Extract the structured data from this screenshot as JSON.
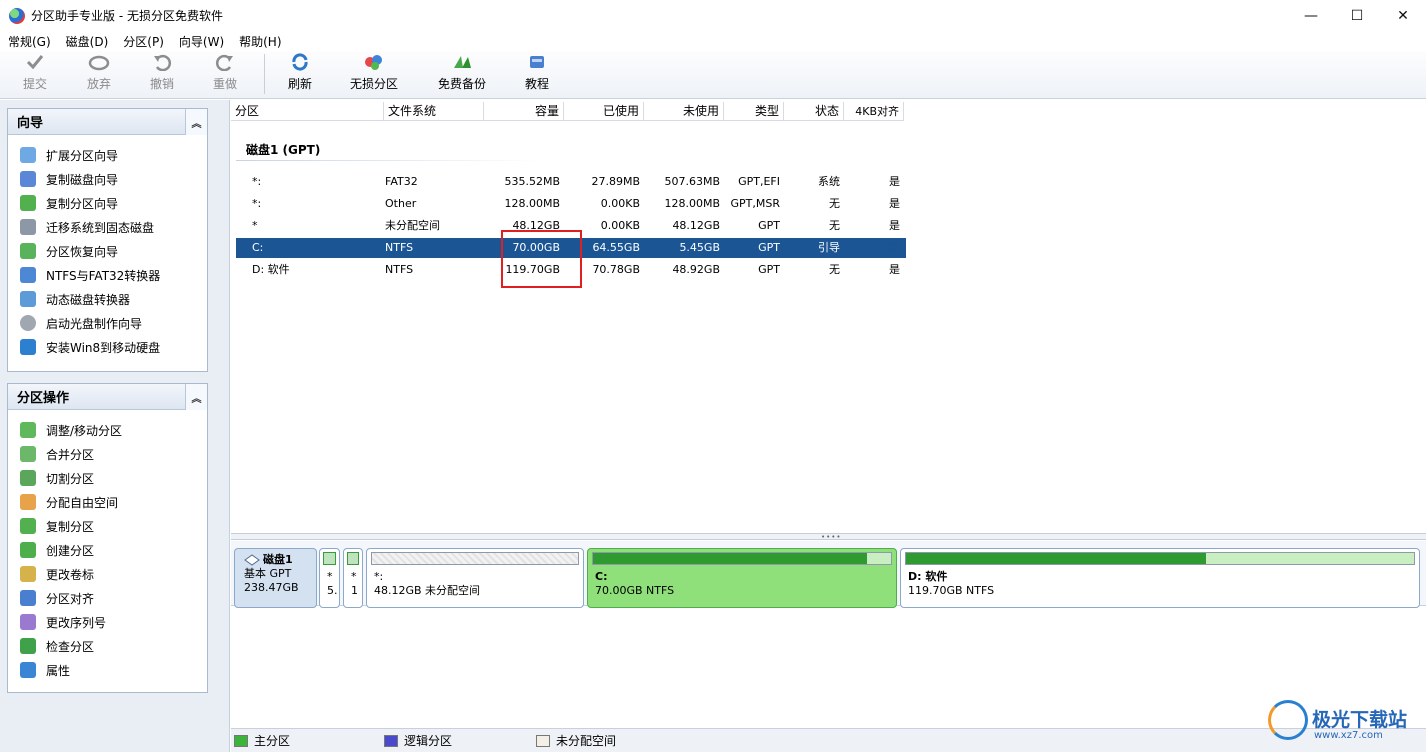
{
  "window": {
    "title": "分区助手专业版 - 无损分区免费软件",
    "minimize": "—",
    "maximize": "☐",
    "close": "✕"
  },
  "menu": [
    "常规(G)",
    "磁盘(D)",
    "分区(P)",
    "向导(W)",
    "帮助(H)"
  ],
  "toolbar": {
    "commit": "提交",
    "discard": "放弃",
    "undo": "撤销",
    "redo": "重做",
    "refresh": "刷新",
    "lossless": "无损分区",
    "backup": "免费备份",
    "tutorial": "教程"
  },
  "wizard_panel": {
    "title": "向导",
    "items": [
      "扩展分区向导",
      "复制磁盘向导",
      "复制分区向导",
      "迁移系统到固态磁盘",
      "分区恢复向导",
      "NTFS与FAT32转换器",
      "动态磁盘转换器",
      "启动光盘制作向导",
      "安装Win8到移动硬盘"
    ]
  },
  "ops_panel": {
    "title": "分区操作",
    "items": [
      "调整/移动分区",
      "合并分区",
      "切割分区",
      "分配自由空间",
      "复制分区",
      "创建分区",
      "更改卷标",
      "分区对齐",
      "更改序列号",
      "检查分区",
      "属性"
    ]
  },
  "columns": [
    "分区",
    "文件系统",
    "容量",
    "已使用",
    "未使用",
    "类型",
    "状态",
    "4KB对齐"
  ],
  "disk_label": "磁盘1 (GPT)",
  "rows": [
    {
      "name": "*:",
      "fs": "FAT32",
      "cap": "535.52MB",
      "used": "27.89MB",
      "free": "507.63MB",
      "type": "GPT,EFI",
      "status": "系统",
      "align": "是"
    },
    {
      "name": "*:",
      "fs": "Other",
      "cap": "128.00MB",
      "used": "0.00KB",
      "free": "128.00MB",
      "type": "GPT,MSR",
      "status": "无",
      "align": "是"
    },
    {
      "name": "*",
      "fs": "未分配空间",
      "cap": "48.12GB",
      "used": "0.00KB",
      "free": "48.12GB",
      "type": "GPT",
      "status": "无",
      "align": "是"
    },
    {
      "name": "C:",
      "fs": "NTFS",
      "cap": "70.00GB",
      "used": "64.55GB",
      "free": "5.45GB",
      "type": "GPT",
      "status": "引导",
      "align": "是"
    },
    {
      "name": "D: 软件",
      "fs": "NTFS",
      "cap": "119.70GB",
      "used": "70.78GB",
      "free": "48.92GB",
      "type": "GPT",
      "status": "无",
      "align": "是"
    }
  ],
  "diskmap": {
    "disk": {
      "name": "磁盘1",
      "type": "基本 GPT",
      "size": "238.47GB"
    },
    "small1": {
      "a": "*",
      "b": "5."
    },
    "small2": {
      "a": "*",
      "b": "1"
    },
    "unalloc": {
      "label": "*:",
      "detail": "48.12GB 未分配空间"
    },
    "c": {
      "label": "C:",
      "detail": "70.00GB NTFS",
      "used_fraction": 0.92
    },
    "d": {
      "label": "D: 软件",
      "detail": "119.70GB NTFS",
      "used_fraction": 0.59
    }
  },
  "legend": {
    "primary": "主分区",
    "logical": "逻辑分区",
    "unallocated": "未分配空间"
  },
  "colors": {
    "selected_row": "#1b5593",
    "highlight_box": "#e02020",
    "primary": "#3cb43c",
    "logical": "#4a4acc"
  },
  "watermark": {
    "name": "极光下载站",
    "url": "www.xz7.com"
  }
}
